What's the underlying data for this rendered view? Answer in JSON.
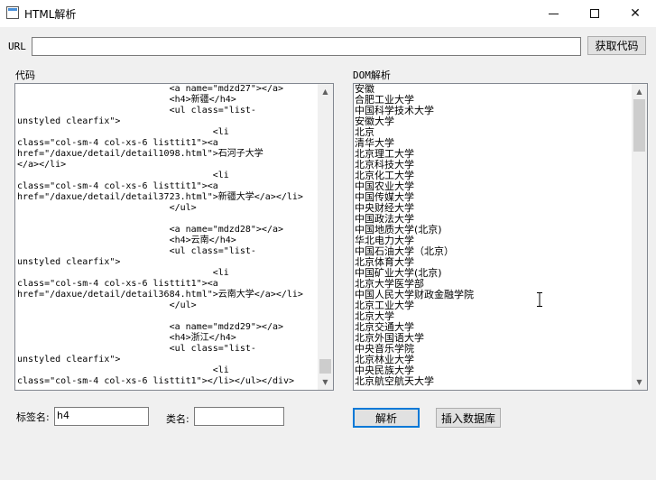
{
  "window": {
    "title": "HTML解析"
  },
  "url": {
    "label": "URL",
    "value": "",
    "fetch_button": "获取代码"
  },
  "code": {
    "label": "代码",
    "content": "                            <a name=\"mdzd27\"></a>\n                            <h4>新疆</h4>\n                            <ul class=\"list-\nunstyled clearfix\">\n                                    <li\nclass=\"col-sm-4 col-xs-6 listtit1\"><a\nhref=\"/daxue/detail/detail1098.html\">石河子大学\n</a></li>\n                                    <li\nclass=\"col-sm-4 col-xs-6 listtit1\"><a\nhref=\"/daxue/detail/detail3723.html\">新疆大学</a></li>\n                            </ul>\n\n                            <a name=\"mdzd28\"></a>\n                            <h4>云南</h4>\n                            <ul class=\"list-\nunstyled clearfix\">\n                                    <li\nclass=\"col-sm-4 col-xs-6 listtit1\"><a\nhref=\"/daxue/detail/detail3684.html\">云南大学</a></li>\n                            </ul>\n\n                            <a name=\"mdzd29\"></a>\n                            <h4>浙江</h4>\n                            <ul class=\"list-\nunstyled clearfix\">\n                                    <li\nclass=\"col-sm-4 col-xs-6 listtit1\"></li></ul></div>"
  },
  "dom": {
    "label": "DOM解析",
    "content": "安徽\n合肥工业大学\n中国科学技术大学\n安徽大学\n北京\n清华大学\n北京理工大学\n北京科技大学\n北京化工大学\n中国农业大学\n中国传媒大学\n中央财经大学\n中国政法大学\n中国地质大学(北京)\n华北电力大学\n中国石油大学（北京）\n北京体育大学\n中国矿业大学(北京)\n北京大学医学部\n中国人民大学财政金融学院\n北京工业大学\n北京大学\n北京交通大学\n北京外国语大学\n中央音乐学院\n北京林业大学\n中央民族大学\n北京航空航天大学"
  },
  "tag": {
    "label": "标签名:",
    "value": "h4"
  },
  "class_field": {
    "label": "类名:",
    "value": ""
  },
  "actions": {
    "parse": "解析",
    "insert": "插入数据库"
  }
}
